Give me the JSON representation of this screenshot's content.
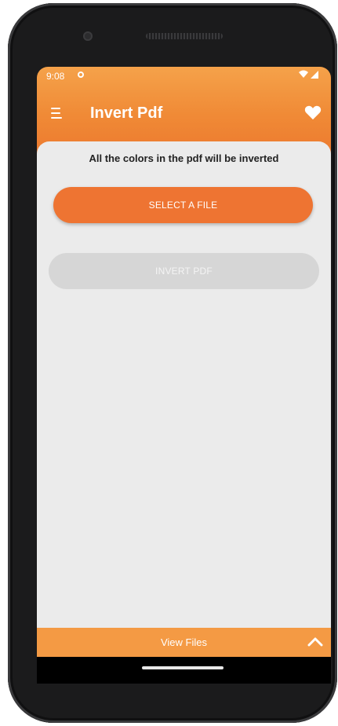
{
  "status_bar": {
    "time": "9:08"
  },
  "toolbar": {
    "title": "Invert Pdf",
    "menu_icon": "menu-icon",
    "favorite_icon": "heart-icon"
  },
  "main": {
    "description": "All the colors in the pdf will be inverted",
    "select_button_label": "SELECT A FILE",
    "invert_button_label": "INVERT PDF"
  },
  "bottom_bar": {
    "label": "View Files",
    "icon": "chevron-up-icon"
  },
  "colors": {
    "accent": "#ee7432",
    "bottom_bar": "#f49a44",
    "disabled": "#d6d6d6",
    "background": "#ebebeb"
  }
}
